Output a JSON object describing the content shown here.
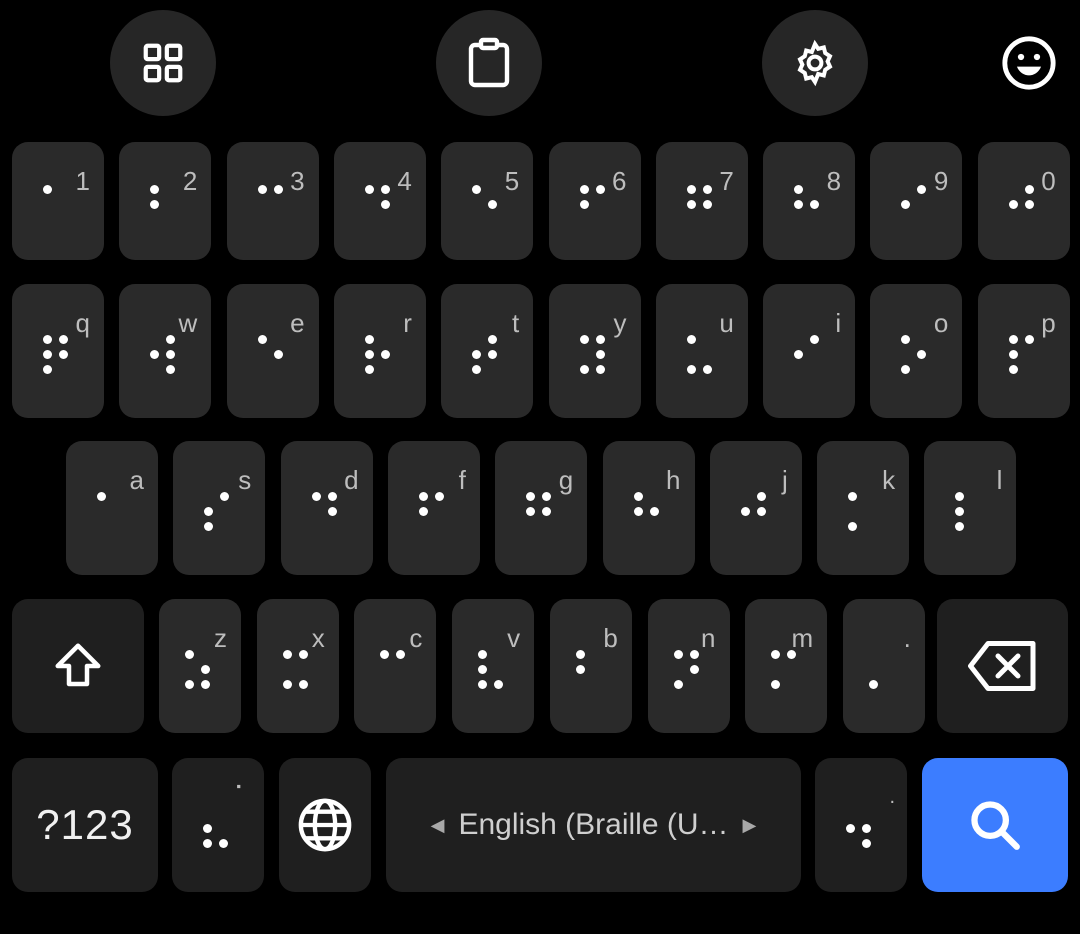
{
  "toolbar": {
    "items": [
      {
        "name": "apps-grid-icon"
      },
      {
        "name": "clipboard-icon"
      },
      {
        "name": "settings-gear-icon"
      },
      {
        "name": "emoji-icon"
      }
    ]
  },
  "rows": {
    "numbers": [
      {
        "label": "1",
        "dots": [
          1
        ]
      },
      {
        "label": "2",
        "dots": [
          1,
          2
        ]
      },
      {
        "label": "3",
        "dots": [
          1,
          4
        ]
      },
      {
        "label": "4",
        "dots": [
          1,
          4,
          5
        ]
      },
      {
        "label": "5",
        "dots": [
          1,
          5
        ]
      },
      {
        "label": "6",
        "dots": [
          1,
          2,
          4
        ]
      },
      {
        "label": "7",
        "dots": [
          1,
          2,
          4,
          5
        ]
      },
      {
        "label": "8",
        "dots": [
          1,
          2,
          5
        ]
      },
      {
        "label": "9",
        "dots": [
          2,
          4
        ]
      },
      {
        "label": "0",
        "dots": [
          2,
          4,
          5
        ]
      }
    ],
    "top": [
      {
        "label": "q",
        "dots": [
          1,
          2,
          3,
          4,
          5
        ]
      },
      {
        "label": "w",
        "dots": [
          2,
          4,
          5,
          6
        ]
      },
      {
        "label": "e",
        "dots": [
          1,
          5
        ]
      },
      {
        "label": "r",
        "dots": [
          1,
          2,
          3,
          5
        ]
      },
      {
        "label": "t",
        "dots": [
          2,
          3,
          4,
          5
        ]
      },
      {
        "label": "y",
        "dots": [
          1,
          3,
          4,
          5,
          6
        ]
      },
      {
        "label": "u",
        "dots": [
          1,
          3,
          6
        ]
      },
      {
        "label": "i",
        "dots": [
          2,
          4
        ]
      },
      {
        "label": "o",
        "dots": [
          1,
          3,
          5
        ]
      },
      {
        "label": "p",
        "dots": [
          1,
          2,
          3,
          4
        ]
      }
    ],
    "home": [
      {
        "label": "a",
        "dots": [
          1
        ]
      },
      {
        "label": "s",
        "dots": [
          2,
          3,
          4
        ]
      },
      {
        "label": "d",
        "dots": [
          1,
          4,
          5
        ]
      },
      {
        "label": "f",
        "dots": [
          1,
          2,
          4
        ]
      },
      {
        "label": "g",
        "dots": [
          1,
          2,
          4,
          5
        ]
      },
      {
        "label": "h",
        "dots": [
          1,
          2,
          5
        ]
      },
      {
        "label": "j",
        "dots": [
          2,
          4,
          5
        ]
      },
      {
        "label": "k",
        "dots": [
          1,
          3
        ]
      },
      {
        "label": "l",
        "dots": [
          1,
          2,
          3
        ]
      }
    ],
    "bottom": [
      {
        "label": "z",
        "dots": [
          1,
          3,
          5,
          6
        ]
      },
      {
        "label": "x",
        "dots": [
          1,
          3,
          4,
          6
        ]
      },
      {
        "label": "c",
        "dots": [
          1,
          4
        ]
      },
      {
        "label": "v",
        "dots": [
          1,
          2,
          3,
          6
        ]
      },
      {
        "label": "b",
        "dots": [
          1,
          2
        ]
      },
      {
        "label": "n",
        "dots": [
          1,
          3,
          4,
          5
        ]
      },
      {
        "label": "m",
        "dots": [
          1,
          3,
          4
        ]
      },
      {
        "label": ".",
        "dots": [
          3
        ]
      }
    ]
  },
  "bottom_row": {
    "symbols_label": "?123",
    "comma_key": {
      "label": "⠂",
      "dots": [
        2,
        3,
        6
      ]
    },
    "space_label": "English (Braille (U…",
    "period_key": {
      "label": ".",
      "dots": [
        2,
        5,
        6
      ]
    }
  },
  "colors": {
    "action": "#3c7dff",
    "key": "#2a2a2a",
    "key_dark": "#1f1f1f"
  }
}
